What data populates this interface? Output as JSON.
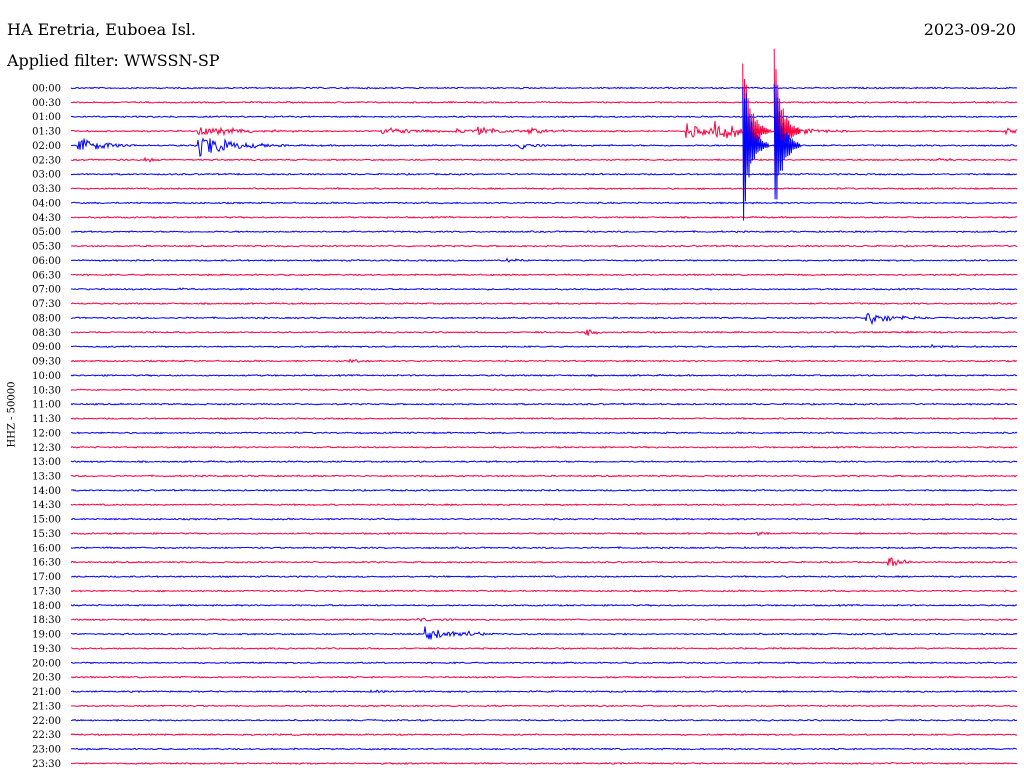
{
  "header": {
    "station": "HA Eretria, Euboea Isl.",
    "filter": "Applied filter: WWSSN-SP",
    "date": "2023-09-20",
    "channel": "HHZ - 50000"
  },
  "colors": {
    "even_rows": "#0000ff",
    "odd_rows": "#ff0040"
  },
  "chart_data": {
    "type": "helicorder",
    "title": "HA Eretria, Euboea Isl.",
    "subtitle": "Applied filter: WWSSN-SP",
    "date": "2023-09-20",
    "ylabel": "HHZ - 50000",
    "row_labels": [
      "00:00",
      "00:30",
      "01:00",
      "01:30",
      "02:00",
      "02:30",
      "03:00",
      "03:30",
      "04:00",
      "04:30",
      "05:00",
      "05:30",
      "06:00",
      "06:30",
      "07:00",
      "07:30",
      "08:00",
      "08:30",
      "09:00",
      "09:30",
      "10:00",
      "10:30",
      "11:00",
      "11:30",
      "12:00",
      "12:30",
      "13:00",
      "13:30",
      "14:00",
      "14:30",
      "15:00",
      "15:30",
      "16:00",
      "16:30",
      "17:00",
      "17:30",
      "18:00",
      "18:30",
      "19:00",
      "19:30",
      "20:00",
      "20:30",
      "21:00",
      "21:30",
      "22:00",
      "22:30",
      "23:00",
      "23:30"
    ],
    "minutes_per_row": 30,
    "events": [
      {
        "row": 3,
        "minute": 4.6,
        "amp": 0.4,
        "dur": 3
      },
      {
        "row": 3,
        "minute": 4.0,
        "amp": 0.6,
        "dur": 2
      },
      {
        "row": 3,
        "minute": 5.0,
        "amp": 0.3,
        "dur": 2
      },
      {
        "row": 3,
        "minute": 9.8,
        "amp": 0.5,
        "dur": 3
      },
      {
        "row": 3,
        "minute": 12.2,
        "amp": 0.3,
        "dur": 2
      },
      {
        "row": 3,
        "minute": 12.8,
        "amp": 0.6,
        "dur": 2
      },
      {
        "row": 3,
        "minute": 14.4,
        "amp": 0.5,
        "dur": 2
      },
      {
        "row": 3,
        "minute": 19.5,
        "amp": 1.0,
        "dur": 2
      },
      {
        "row": 3,
        "minute": 20.4,
        "amp": 1.6,
        "dur": 2
      },
      {
        "row": 3,
        "minute": 23.0,
        "amp": 0.5,
        "dur": 2
      },
      {
        "row": 3,
        "minute": 29.6,
        "amp": 0.5,
        "dur": 1
      },
      {
        "row": 4,
        "minute": 0.2,
        "amp": 1.2,
        "dur": 2
      },
      {
        "row": 4,
        "minute": 4.0,
        "amp": 1.5,
        "dur": 3
      },
      {
        "row": 4,
        "minute": 14.2,
        "amp": 0.6,
        "dur": 1
      },
      {
        "row": 5,
        "minute": 2.2,
        "amp": 0.4,
        "dur": 1
      },
      {
        "row": 5,
        "minute": 27.5,
        "amp": 0.2,
        "dur": 1
      },
      {
        "row": 12,
        "minute": 13.8,
        "amp": 0.3,
        "dur": 1
      },
      {
        "row": 14,
        "minute": 3.4,
        "amp": 0.2,
        "dur": 1
      },
      {
        "row": 16,
        "minute": 25.2,
        "amp": 1.0,
        "dur": 2
      },
      {
        "row": 17,
        "minute": 16.3,
        "amp": 0.5,
        "dur": 1
      },
      {
        "row": 17,
        "minute": 26.5,
        "amp": 0.2,
        "dur": 1
      },
      {
        "row": 18,
        "minute": 27.3,
        "amp": 0.2,
        "dur": 2
      },
      {
        "row": 19,
        "minute": 8.8,
        "amp": 0.3,
        "dur": 1
      },
      {
        "row": 31,
        "minute": 21.7,
        "amp": 0.3,
        "dur": 1
      },
      {
        "row": 32,
        "minute": 7.9,
        "amp": 0.2,
        "dur": 1
      },
      {
        "row": 33,
        "minute": 25.9,
        "amp": 0.8,
        "dur": 1
      },
      {
        "row": 37,
        "minute": 11.0,
        "amp": 0.2,
        "dur": 2
      },
      {
        "row": 38,
        "minute": 11.2,
        "amp": 1.0,
        "dur": 2
      },
      {
        "row": 38,
        "minute": 12.5,
        "amp": 0.5,
        "dur": 1
      },
      {
        "row": 42,
        "minute": 9.5,
        "amp": 0.2,
        "dur": 1
      }
    ],
    "large_event": {
      "rows": [
        3,
        4
      ],
      "minute": 21.4,
      "amp": 6.0
    }
  }
}
